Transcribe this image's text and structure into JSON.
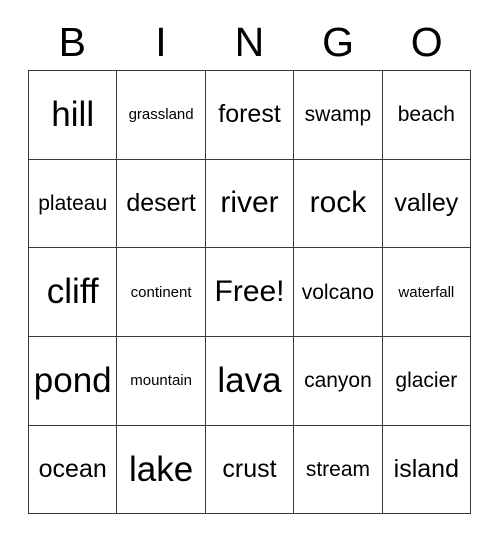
{
  "card": {
    "title": "BINGO",
    "headers": [
      "B",
      "I",
      "N",
      "G",
      "O"
    ],
    "free_space_label": "Free!",
    "colors": {
      "text": "#000000",
      "border": "#3a3a3a",
      "background": "#ffffff"
    },
    "rows": [
      [
        {
          "label": "hill",
          "size": "xl"
        },
        {
          "label": "grassland",
          "size": "xs"
        },
        {
          "label": "forest",
          "size": "md"
        },
        {
          "label": "swamp",
          "size": "sm"
        },
        {
          "label": "beach",
          "size": "sm"
        }
      ],
      [
        {
          "label": "plateau",
          "size": "sm"
        },
        {
          "label": "desert",
          "size": "md"
        },
        {
          "label": "river",
          "size": "lg"
        },
        {
          "label": "rock",
          "size": "lg"
        },
        {
          "label": "valley",
          "size": "md"
        }
      ],
      [
        {
          "label": "cliff",
          "size": "xl"
        },
        {
          "label": "continent",
          "size": "xs"
        },
        {
          "label": "Free!",
          "size": "lg"
        },
        {
          "label": "volcano",
          "size": "sm"
        },
        {
          "label": "waterfall",
          "size": "xs"
        }
      ],
      [
        {
          "label": "pond",
          "size": "xl"
        },
        {
          "label": "mountain",
          "size": "xs"
        },
        {
          "label": "lava",
          "size": "xl"
        },
        {
          "label": "canyon",
          "size": "sm"
        },
        {
          "label": "glacier",
          "size": "sm"
        }
      ],
      [
        {
          "label": "ocean",
          "size": "md"
        },
        {
          "label": "lake",
          "size": "xl"
        },
        {
          "label": "crust",
          "size": "md"
        },
        {
          "label": "stream",
          "size": "sm"
        },
        {
          "label": "island",
          "size": "md"
        }
      ]
    ]
  }
}
